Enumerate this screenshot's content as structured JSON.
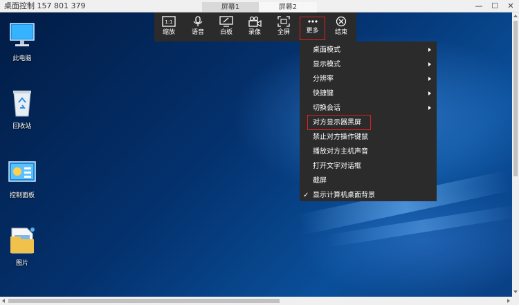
{
  "window": {
    "title": "桌面控制 157 801 379",
    "tabs": [
      {
        "label": "屏幕1"
      },
      {
        "label": "屏幕2"
      }
    ],
    "controls": {
      "minimize": "—",
      "maximize": "☐",
      "close": "✕"
    }
  },
  "desktop": {
    "icons": [
      {
        "label": "此电脑",
        "icon": "computer-icon"
      },
      {
        "label": "回收站",
        "icon": "recycle-bin-icon"
      },
      {
        "label": "控制面板",
        "icon": "control-panel-icon"
      },
      {
        "label": "图片",
        "icon": "folder-icon"
      }
    ]
  },
  "toolbar": {
    "items": [
      {
        "label": "缩放",
        "icon": "zoom-ratio-icon"
      },
      {
        "label": "语音",
        "icon": "microphone-icon"
      },
      {
        "label": "白板",
        "icon": "whiteboard-icon"
      },
      {
        "label": "录像",
        "icon": "camera-icon"
      },
      {
        "label": "全屏",
        "icon": "fullscreen-icon"
      },
      {
        "label": "更多",
        "icon": "more-icon"
      },
      {
        "label": "结束",
        "icon": "close-circle-icon"
      }
    ],
    "zoom_badge": "1:1"
  },
  "menu": {
    "items": [
      {
        "label": "桌面模式",
        "submenu": true
      },
      {
        "label": "显示模式",
        "submenu": true
      },
      {
        "label": "分辨率",
        "submenu": true
      },
      {
        "label": "快捷键",
        "submenu": true
      },
      {
        "label": "切换会话",
        "submenu": true
      },
      {
        "label": "对方显示器黑屏",
        "submenu": false,
        "highlighted": true
      },
      {
        "label": "禁止对方操作键鼠",
        "submenu": false
      },
      {
        "label": "播放对方主机声音",
        "submenu": false
      },
      {
        "label": "打开文字对话框",
        "submenu": false
      },
      {
        "label": "截屏",
        "submenu": false
      },
      {
        "label": "显示计算机桌面背景",
        "submenu": false,
        "checked": true
      }
    ],
    "check_mark": "✓"
  },
  "colors": {
    "toolbar_bg": "#2b2b2b",
    "highlight_border": "#e02020",
    "desktop_base": "#04326f"
  }
}
